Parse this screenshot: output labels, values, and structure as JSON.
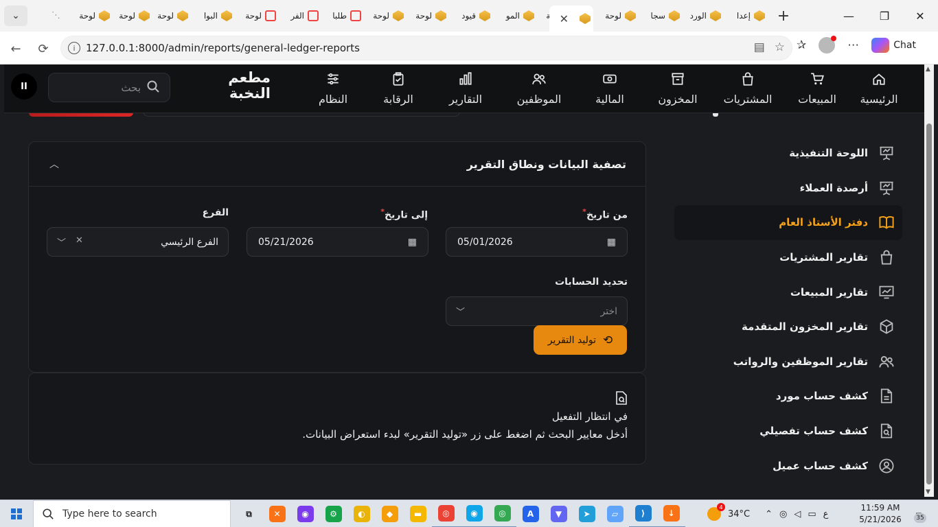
{
  "browser": {
    "tabs": [
      {
        "label": "",
        "icon": "rss-icon",
        "active": false
      },
      {
        "label": "لوحة",
        "icon": "gold-logo-icon",
        "active": false
      },
      {
        "label": "لوحة",
        "icon": "gold-logo-icon",
        "active": false
      },
      {
        "label": "لوحة",
        "icon": "gold-logo-icon",
        "active": false
      },
      {
        "label": "البوا",
        "icon": "gold-logo-icon",
        "active": false
      },
      {
        "label": "لوحة",
        "icon": "laravel-icon",
        "active": false
      },
      {
        "label": "الفر",
        "icon": "laravel-icon",
        "active": false
      },
      {
        "label": "طلبا",
        "icon": "laravel-icon",
        "active": false
      },
      {
        "label": "لوحة",
        "icon": "gold-logo-icon",
        "active": false
      },
      {
        "label": "لوحة",
        "icon": "gold-logo-icon",
        "active": false
      },
      {
        "label": "قيود",
        "icon": "gold-logo-icon",
        "active": false
      },
      {
        "label": "المو",
        "icon": "gold-logo-icon",
        "active": false
      },
      {
        "label": "لوحة",
        "icon": "gold-logo-icon",
        "active": false
      },
      {
        "label": "",
        "icon": "gold-logo-icon",
        "active": true
      },
      {
        "label": "لوحة",
        "icon": "gold-logo-icon",
        "active": false
      },
      {
        "label": "سجا",
        "icon": "gold-logo-icon",
        "active": false
      },
      {
        "label": "الورد",
        "icon": "gold-logo-icon",
        "active": false
      },
      {
        "label": "إعدا",
        "icon": "gold-logo-icon",
        "active": false
      }
    ],
    "url": "127.0.0.1:8000/admin/reports/general-ledger-reports",
    "chat_label": "Chat"
  },
  "app": {
    "logo_line1": "مطعم",
    "logo_line2": "النخبة",
    "search_placeholder": "بحث",
    "nav": [
      {
        "label": "الرئيسية",
        "icon": "home-icon"
      },
      {
        "label": "المبيعات",
        "icon": "cart-icon"
      },
      {
        "label": "المشتريات",
        "icon": "shopping-bag-icon"
      },
      {
        "label": "المخزون",
        "icon": "archive-icon"
      },
      {
        "label": "المالية",
        "icon": "money-icon"
      },
      {
        "label": "الموظفين",
        "icon": "users-icon"
      },
      {
        "label": "التقارير",
        "icon": "bar-chart-icon"
      },
      {
        "label": "الرقابة",
        "icon": "clipboard-check-icon"
      },
      {
        "label": "النظام",
        "icon": "sliders-icon"
      }
    ],
    "sidebar": [
      {
        "label": "اللوحة التنفيذية",
        "icon": "presentation-icon",
        "active": false
      },
      {
        "label": "أرصدة العملاء",
        "icon": "presentation-icon",
        "active": false
      },
      {
        "label": "دفتر الأستاذ العام",
        "icon": "book-open-icon",
        "active": true
      },
      {
        "label": "تقارير المشتريات",
        "icon": "shopping-bag-icon",
        "active": false
      },
      {
        "label": "تقارير المبيعات",
        "icon": "chart-line-icon",
        "active": false
      },
      {
        "label": "تقارير المخزون المتقدمة",
        "icon": "cube-icon",
        "active": false
      },
      {
        "label": "تقارير الموظفين والرواتب",
        "icon": "users-icon",
        "active": false
      },
      {
        "label": "كشف حساب مورد",
        "icon": "document-icon",
        "active": false
      },
      {
        "label": "كشف حساب تفصيلي",
        "icon": "document-search-icon",
        "active": false
      },
      {
        "label": "كشف حساب عميل",
        "icon": "user-circle-icon",
        "active": false
      }
    ],
    "filter": {
      "title": "تصفية البيانات ونطاق التقرير",
      "from_label": "من تاريخ",
      "from_value": "05/01/2026",
      "to_label": "إلى تاريخ",
      "to_value": "05/21/2026",
      "branch_label": "الفرع",
      "branch_value": "الفرع الرئيسي",
      "accounts_label": "تحديد الحسابات",
      "accounts_placeholder": "اختر",
      "generate_label": "توليد التقرير"
    },
    "empty_state": {
      "title": "في انتظار التفعيل",
      "description": "أدخل معايير البحث ثم اضغط على زر «توليد التقرير» لبدء استعراض البيانات."
    }
  },
  "taskbar": {
    "search_placeholder": "Type here to search",
    "weather": "34°C",
    "time": "11:59 AM",
    "date": "5/21/2026",
    "notifications": "35",
    "lang": "ع"
  },
  "colors": {
    "accent": "#e8890f",
    "active_text": "#f4a21b",
    "background": "#1b1c1f",
    "card": "#16171a",
    "required": "#ef4444"
  }
}
